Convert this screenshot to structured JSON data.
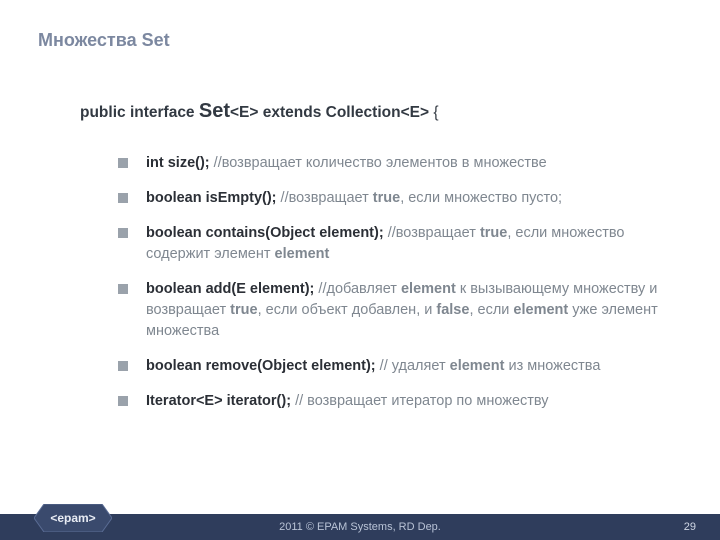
{
  "title": "Множества Set",
  "declaration": {
    "prefix": "public interface ",
    "name": "Set",
    "generic1": "<E>",
    "mid": " extends Collection",
    "generic2": "<E>",
    "suffix": " {"
  },
  "methods": [
    {
      "sig": "int size();",
      "comment_prefix": " //",
      "comment": "возвращает количество элементов в множестве"
    },
    {
      "sig": "boolean isEmpty();",
      "comment_prefix": " //",
      "comment_parts": [
        "возвращает ",
        {
          "kw": "true"
        },
        ", если множество пусто;"
      ]
    },
    {
      "sig": "boolean contains(Object element);",
      "comment_prefix": " //",
      "comment_parts": [
        "возвращает ",
        {
          "kw": "true"
        },
        ", если множество содержит элемент ",
        {
          "kw": "element"
        }
      ]
    },
    {
      "sig": "boolean add(E element);",
      "comment_prefix": " //",
      "comment_parts": [
        "добавляет ",
        {
          "kw": "element"
        },
        " к вызывающему множеству и возвращает ",
        {
          "kw": "true"
        },
        ", если объект добавлен, и ",
        {
          "kw": "false"
        },
        ", если ",
        {
          "kw": "element"
        },
        " уже элемент множества"
      ]
    },
    {
      "sig": "boolean remove(Object element);",
      "comment_prefix": " // ",
      "comment_parts": [
        "удаляет ",
        {
          "kw": "element"
        },
        " из множества"
      ]
    },
    {
      "sig": "Iterator<E> iterator();",
      "comment_prefix": " // ",
      "comment": "возвращает итератор по множеству"
    }
  ],
  "footer": {
    "copyright": "2011 © EPAM Systems, RD Dep.",
    "page": "29",
    "logo_text": "<epam>"
  }
}
